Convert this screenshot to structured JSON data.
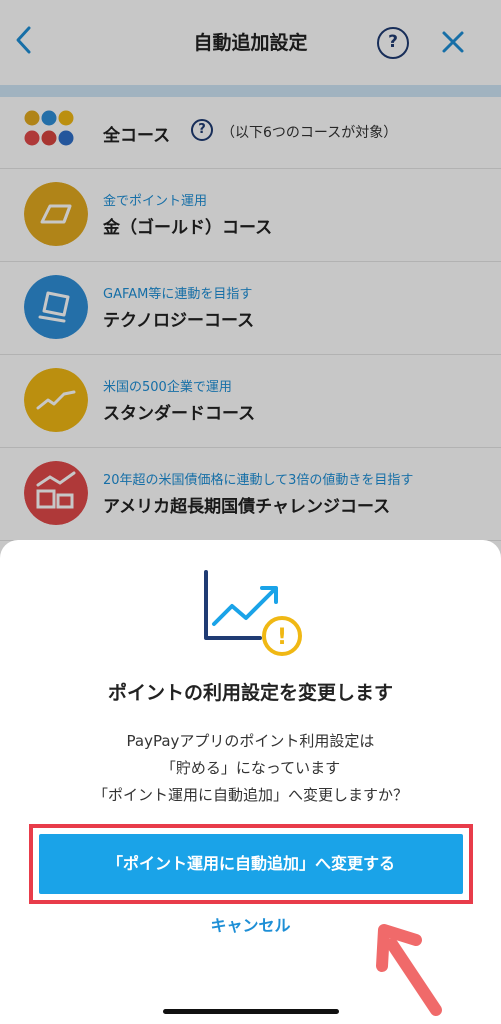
{
  "header": {
    "title": "自動追加設定",
    "help_label": "?"
  },
  "courses": [
    {
      "sub": "",
      "name": "全コース",
      "note": "（以下6つのコースが対象）",
      "help_label": "?"
    },
    {
      "sub": "金でポイント運用",
      "name": "金（ゴールド）コース",
      "color": "#e2a91f"
    },
    {
      "sub": "GAFAM等に連動を目指す",
      "name": "テクノロジーコース",
      "color": "#2f8fd8"
    },
    {
      "sub": "米国の500企業で運用",
      "name": "スタンダードコース",
      "color": "#f0b814"
    },
    {
      "sub": "20年超の米国債価格に連動して3倍の値動きを目指す",
      "name": "アメリカ超長期国債チャレンジコース",
      "color": "#e04a4a"
    }
  ],
  "dialog": {
    "title": "ポイントの利用設定を変更します",
    "message_lines": [
      "PayPayアプリのポイント利用設定は",
      "「貯める」になっています",
      "「ポイント運用に自動追加」へ変更しますか？"
    ],
    "confirm_label": "「ポイント運用に自動追加」へ変更する",
    "cancel_label": "キャンセル",
    "warning_glyph": "!"
  },
  "colors": {
    "accent": "#1aa3e8",
    "highlight": "#e83c4a",
    "link": "#1e8fd6"
  }
}
